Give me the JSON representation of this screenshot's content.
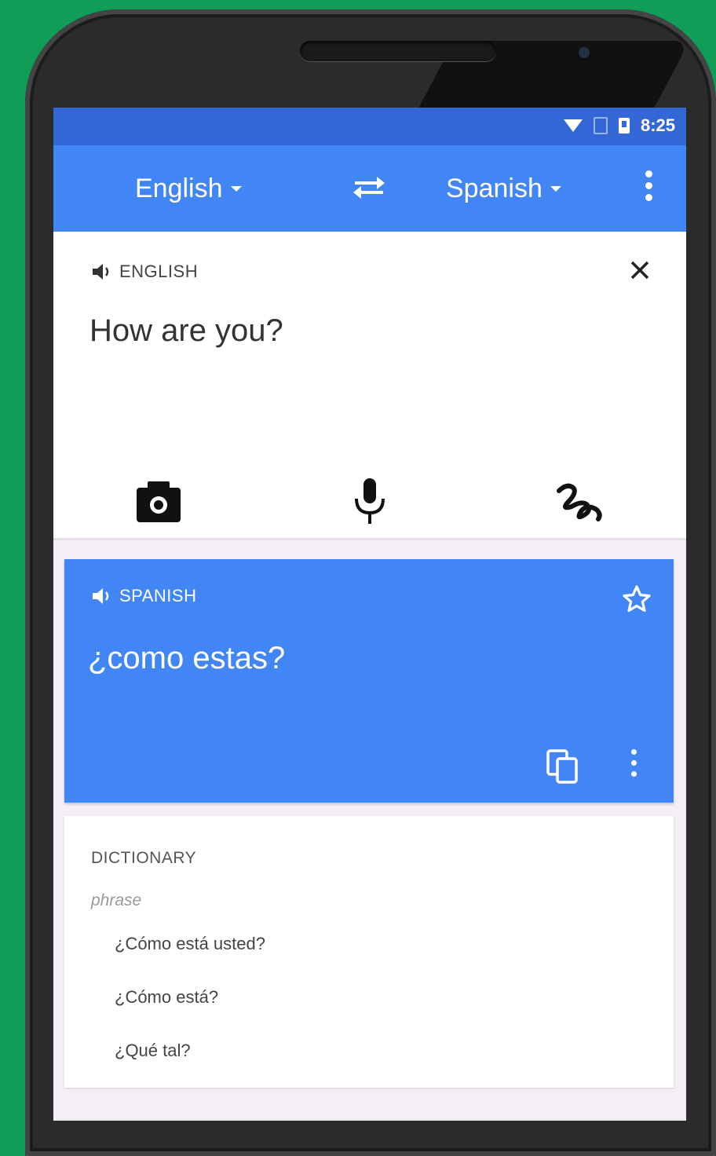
{
  "status_bar": {
    "time": "8:25",
    "icons": [
      "wifi-icon",
      "sim-icon",
      "battery-icon"
    ]
  },
  "app_bar": {
    "source_language": "English",
    "target_language": "Spanish",
    "icons": [
      "swap-languages-icon",
      "overflow-menu-icon"
    ]
  },
  "input": {
    "language_label": "ENGLISH",
    "text": "How are you?",
    "tools": [
      "camera-icon",
      "microphone-icon",
      "handwriting-icon"
    ]
  },
  "output": {
    "language_label": "SPANISH",
    "text": "¿como estas?",
    "icons": [
      "star-icon",
      "copy-icon",
      "overflow-menu-icon"
    ]
  },
  "dictionary": {
    "title": "DICTIONARY",
    "part_of_speech": "phrase",
    "entries": [
      "¿Cómo está usted?",
      "¿Cómo está?",
      "¿Qué tal?"
    ]
  },
  "colors": {
    "background": "#0f9d58",
    "status_bar": "#3367d6",
    "app_bar": "#4285f4",
    "output_card": "#4285f4"
  }
}
